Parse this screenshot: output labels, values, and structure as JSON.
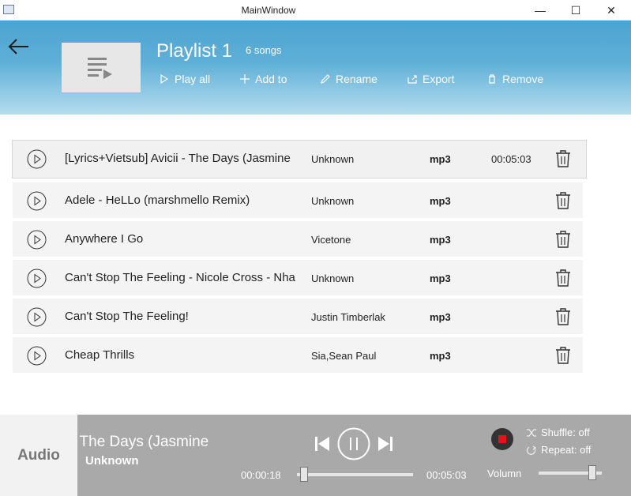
{
  "window": {
    "title": "MainWindow",
    "minimize": "—",
    "maximize": "☐",
    "close": "✕"
  },
  "header": {
    "playlist_title": "Playlist 1",
    "song_count": "6 songs",
    "actions": [
      {
        "label": "Play all",
        "icon": "play-icon"
      },
      {
        "label": "Add to",
        "icon": "plus-icon"
      },
      {
        "label": "Rename",
        "icon": "pencil-icon"
      },
      {
        "label": "Export",
        "icon": "export-icon"
      },
      {
        "label": "Remove",
        "icon": "trash-icon"
      }
    ],
    "colors": {
      "top": "#4aa3d0",
      "bottom": "#b6dced"
    }
  },
  "songs": [
    {
      "title": "[Lyrics+Vietsub] Avicii - The Days (Jasmine",
      "artist": "Unknown",
      "format": "mp3",
      "duration": "00:05:03"
    },
    {
      "title": "Adele - HeLLo (marshmello Remix)",
      "artist": "Unknown",
      "format": "mp3",
      "duration": ""
    },
    {
      "title": "Anywhere I Go",
      "artist": "Vicetone",
      "format": "mp3",
      "duration": ""
    },
    {
      "title": "Can't Stop The Feeling - Nicole Cross - Nha",
      "artist": "Unknown",
      "format": "mp3",
      "duration": ""
    },
    {
      "title": "Can't Stop The Feeling!",
      "artist": "Justin Timberlak",
      "format": "mp3",
      "duration": ""
    },
    {
      "title": "Cheap Thrills",
      "artist": "Sia,Sean Paul",
      "format": "mp3",
      "duration": ""
    }
  ],
  "player": {
    "tile_label": "Audio",
    "now_playing_title": "Avicii - The Days (Jasmine",
    "now_playing_artist": "Unknown",
    "elapsed": "00:00:18",
    "total": "00:05:03",
    "progress_fraction": 0.06,
    "shuffle": "Shuffle: off",
    "repeat": "Repeat: off",
    "volume_label": "Volumn",
    "volume_fraction": 0.85,
    "colors": {
      "bar": "#a9a9a9",
      "record": "#e8101a"
    }
  }
}
